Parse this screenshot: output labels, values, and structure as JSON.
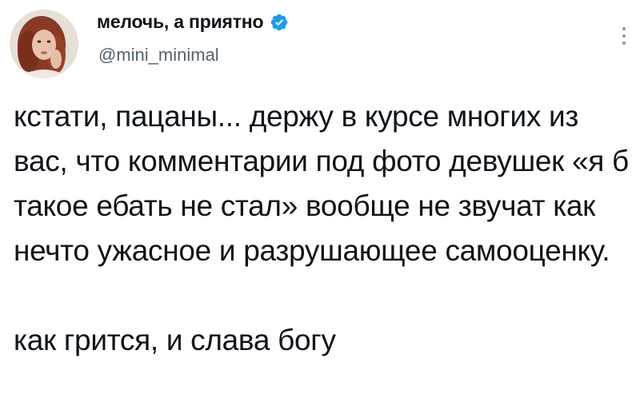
{
  "author": {
    "display_name": "мелочь, а приятно",
    "handle": "@mini_minimal",
    "verified": true,
    "verified_color": "#1d9bf0"
  },
  "tweet": {
    "paragraph_1": "кстати, пацаны... держу в курсе многих из вас, что комментарии под фото девушек «я б такое ебать не стал» вообще не звучат как нечто ужасное и разрушающее самооценку.",
    "paragraph_2": "как грится, и слава богу"
  },
  "icons": {
    "verified": "verified-badge-icon",
    "more": "more-options-icon"
  },
  "colors": {
    "text": "#0f1419",
    "secondary_text": "#536471",
    "background": "#ffffff"
  }
}
